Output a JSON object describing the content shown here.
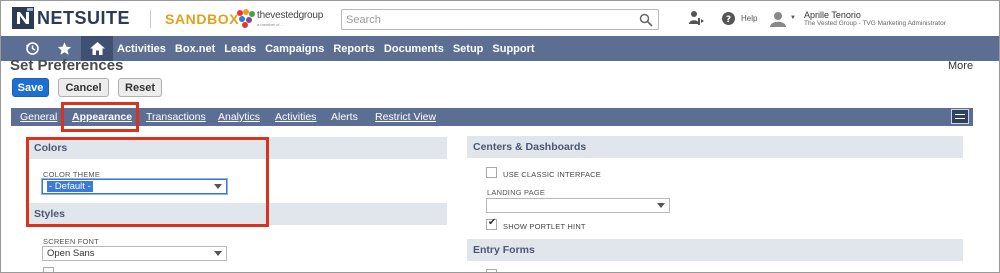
{
  "header": {
    "logo_text": "NETSUITE",
    "environment_badge": "SANDBOX",
    "company_logo_text": "thevestedgroup",
    "company_logo_subtext": "a member of ...",
    "search_placeholder": "Search",
    "help_label": "Help",
    "user_name": "Aprille Tenorio",
    "user_role": "The Vested Group - TVG Marketing Administrator"
  },
  "nav": {
    "items": [
      "Activities",
      "Box.net",
      "Leads",
      "Campaigns",
      "Reports",
      "Documents",
      "Setup",
      "Support"
    ]
  },
  "page": {
    "title": "Set Preferences",
    "more_label": "More",
    "buttons": {
      "save": "Save",
      "cancel": "Cancel",
      "reset": "Reset"
    }
  },
  "subtabs": {
    "items": [
      "General",
      "Appearance",
      "Transactions",
      "Analytics",
      "Activities",
      "Alerts",
      "Restrict View"
    ],
    "active": "Appearance"
  },
  "left_column": {
    "colors": {
      "heading": "Colors",
      "color_theme_label": "COLOR THEME",
      "color_theme_value": "- Default -"
    },
    "styles": {
      "heading": "Styles",
      "screen_font_label": "SCREEN FONT",
      "screen_font_value": "Open Sans"
    }
  },
  "right_column": {
    "centers": {
      "heading": "Centers & Dashboards",
      "use_classic_label": "USE CLASSIC INTERFACE",
      "use_classic_checked": false,
      "landing_page_label": "LANDING PAGE",
      "landing_page_value": "",
      "show_portlet_hint_label": "SHOW PORTLET HINT",
      "show_portlet_hint_checked": true
    },
    "entry_forms": {
      "heading": "Entry Forms"
    }
  },
  "colors": {
    "nav_bar": "#5c6f93",
    "highlight_red": "#d9331e",
    "save_blue": "#1f6fd0",
    "sandbox_gold": "#e0a21b"
  }
}
